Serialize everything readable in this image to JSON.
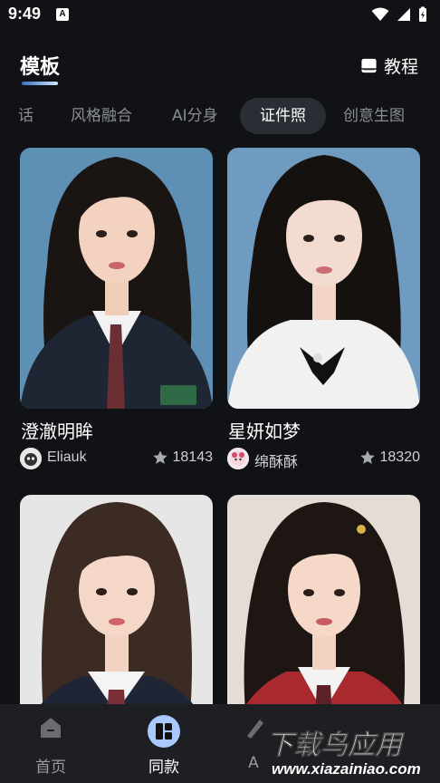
{
  "status_bar": {
    "time": "9:49",
    "notification_icon": "A",
    "icons": [
      "wifi-icon",
      "signal-icon",
      "battery-charging-icon"
    ]
  },
  "header": {
    "title": "模板",
    "tutorial_label": "教程",
    "tutorial_icon": "book-icon"
  },
  "tabs": [
    {
      "label": "话",
      "active": false
    },
    {
      "label": "风格融合",
      "active": false
    },
    {
      "label": "AI分身",
      "active": false
    },
    {
      "label": "证件照",
      "active": true
    },
    {
      "label": "创意生图",
      "active": false
    }
  ],
  "cards": [
    {
      "title": "澄澈明眸",
      "author": "Eliauk",
      "likes": "18143",
      "background": "#5e8fb4"
    },
    {
      "title": "星妍如梦",
      "author": "绵酥酥",
      "likes": "18320",
      "background": "#6f9bc0"
    },
    {
      "title": "",
      "author": "",
      "likes": "",
      "background": "#e6e6e6"
    },
    {
      "title": "",
      "author": "",
      "likes": "",
      "background": "#e4ddd6"
    }
  ],
  "bottom_nav": [
    {
      "label": "首页",
      "icon": "home-icon",
      "active": false
    },
    {
      "label": "同款",
      "icon": "grid-icon",
      "active": true
    },
    {
      "label": "A",
      "icon": "ai-icon",
      "active": false
    }
  ],
  "watermark": {
    "title": "下载鸟应用",
    "url": "www.xiazainiao.com"
  },
  "colors": {
    "background": "#111215",
    "tab_active_bg": "#2a2d33",
    "nav_bg": "#1d1f23",
    "accent": "#3a6fb8"
  }
}
